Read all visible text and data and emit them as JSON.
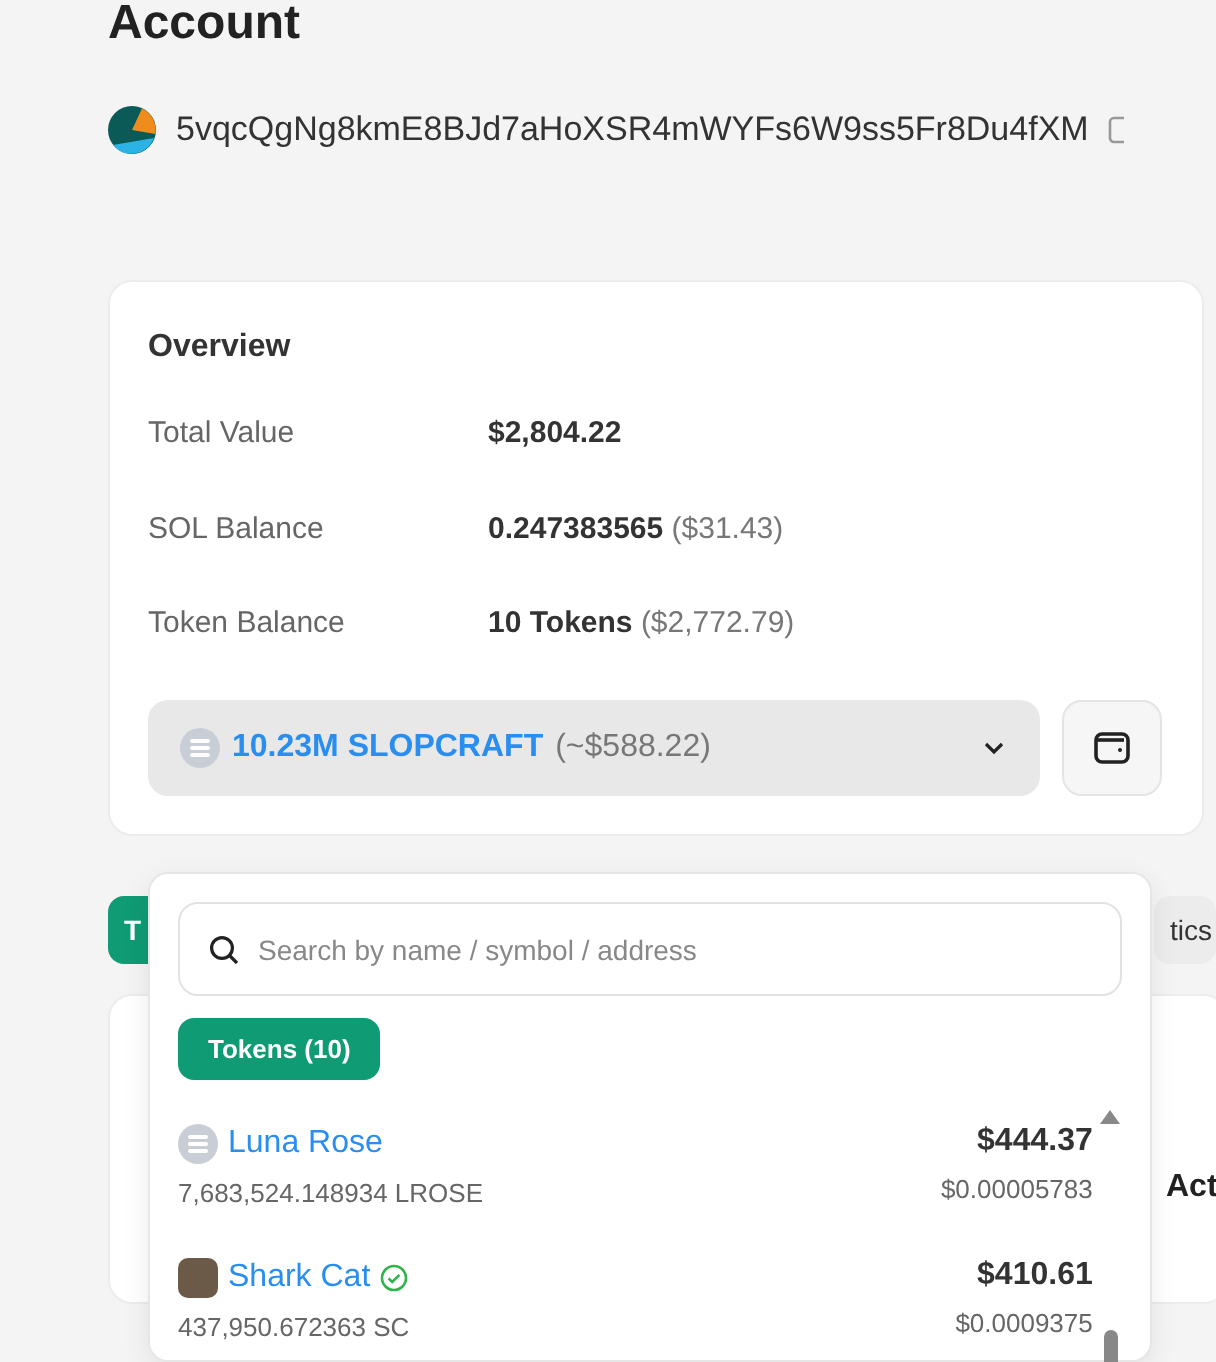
{
  "page": {
    "title": "Account"
  },
  "account": {
    "address": "5vqcQgNg8kmE8BJd7aHoXSR4mWYFs6W9ss5Fr8Du4fXM"
  },
  "overview": {
    "title": "Overview",
    "rows": [
      {
        "label": "Total Value",
        "value": "$2,804.22",
        "note": ""
      },
      {
        "label": "SOL Balance",
        "value": "0.247383565",
        "note": "($31.43)"
      },
      {
        "label": "Token Balance",
        "value": "10 Tokens",
        "note": "($2,772.79)"
      }
    ],
    "token_select": {
      "selected_amount": "10.23M SLOPCRAFT",
      "selected_value": "(~$588.22)",
      "expanded": true
    }
  },
  "tabs_behind": [
    {
      "label": "T",
      "selected": true
    },
    {
      "label": "tics",
      "selected": false
    }
  ],
  "section_behind": {
    "heading": "Act"
  },
  "token_dropdown": {
    "search": {
      "placeholder": "Search by name / symbol / address"
    },
    "filter_chip": "Tokens (10)",
    "tokens": [
      {
        "kind": "generic",
        "name": "Luna Rose",
        "verified": false,
        "amount": "7,683,524.148934 LROSE",
        "value": "$444.37",
        "price": "$0.00005783"
      },
      {
        "kind": "photo",
        "name": "Shark Cat",
        "verified": true,
        "amount": "437,950.672363 SC",
        "value": "$410.61",
        "price": "$0.0009375"
      }
    ]
  }
}
